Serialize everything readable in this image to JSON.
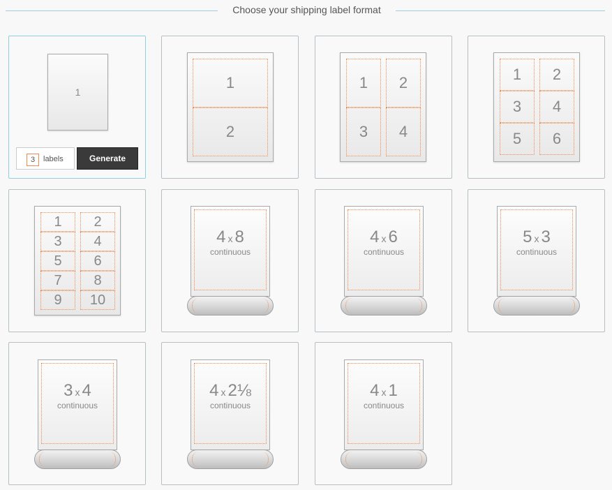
{
  "header": {
    "title": "Choose your shipping label format"
  },
  "formats": [
    {
      "id": "sheet-1",
      "labels": [
        "1"
      ]
    },
    {
      "id": "sheet-2",
      "labels": [
        "1",
        "2"
      ]
    },
    {
      "id": "sheet-4",
      "labels": [
        "1",
        "2",
        "3",
        "4"
      ]
    },
    {
      "id": "sheet-6",
      "labels": [
        "1",
        "2",
        "3",
        "4",
        "5",
        "6"
      ]
    },
    {
      "id": "sheet-10",
      "labels": [
        "1",
        "2",
        "3",
        "4",
        "5",
        "6",
        "7",
        "8",
        "9",
        "10"
      ]
    },
    {
      "id": "roll-4x8",
      "w": "4",
      "h": "8",
      "sub": "continuous"
    },
    {
      "id": "roll-4x6",
      "w": "4",
      "h": "6",
      "sub": "continuous"
    },
    {
      "id": "roll-5x3",
      "w": "5",
      "h": "3",
      "sub": "continuous"
    },
    {
      "id": "roll-3x4",
      "w": "3",
      "h": "4",
      "sub": "continuous"
    },
    {
      "id": "roll-4x2-1/8",
      "w": "4",
      "h": "2⅛",
      "sub": "continuous"
    },
    {
      "id": "roll-4x1",
      "w": "4",
      "h": "1",
      "sub": "continuous"
    }
  ],
  "times_symbol": "x",
  "controls": {
    "quantity": "3",
    "quantity_label": "labels",
    "generate_label": "Generate"
  },
  "colors": {
    "accent_orange": "#ef8a4c",
    "selected_border": "#8fd0e0",
    "button_dark": "#3a3a3a"
  }
}
